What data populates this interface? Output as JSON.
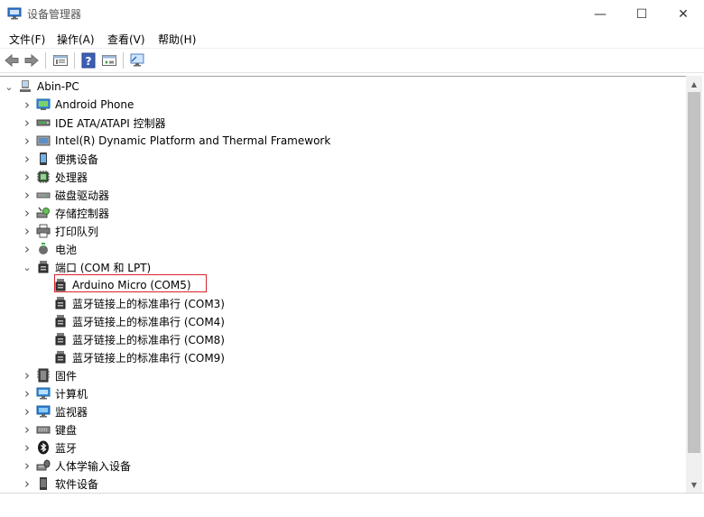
{
  "window": {
    "title": "设备管理器",
    "minimize_glyph": "—",
    "maximize_glyph": "☐",
    "close_glyph": "✕"
  },
  "menu": {
    "items": [
      "文件(F)",
      "操作(A)",
      "查看(V)",
      "帮助(H)"
    ]
  },
  "toolbar": {
    "icons": [
      "back-arrow-icon",
      "forward-arrow-icon",
      "properties-icon",
      "help-icon",
      "view-icon",
      "scan-monitor-icon"
    ]
  },
  "tree": {
    "root_label": "Abin-PC",
    "items": [
      {
        "label": "Android Phone",
        "icon": "android-phone-icon"
      },
      {
        "label": "IDE ATA/ATAPI 控制器",
        "icon": "ide-controller-icon"
      },
      {
        "label": "Intel(R) Dynamic Platform and Thermal Framework",
        "icon": "intel-framework-icon"
      },
      {
        "label": "便携设备",
        "icon": "portable-device-icon"
      },
      {
        "label": "处理器",
        "icon": "processor-icon"
      },
      {
        "label": "磁盘驱动器",
        "icon": "disk-drive-icon"
      },
      {
        "label": "存储控制器",
        "icon": "storage-controller-icon"
      },
      {
        "label": "打印队列",
        "icon": "print-queue-icon"
      },
      {
        "label": "电池",
        "icon": "battery-icon"
      },
      {
        "label": "端口 (COM 和 LPT)",
        "icon": "port-icon",
        "expanded": true
      },
      {
        "label": "Arduino Micro (COM5)",
        "icon": "port-icon",
        "child": true
      },
      {
        "label": "蓝牙链接上的标准串行 (COM3)",
        "icon": "port-icon",
        "child": true
      },
      {
        "label": "蓝牙链接上的标准串行 (COM4)",
        "icon": "port-icon",
        "child": true
      },
      {
        "label": "蓝牙链接上的标准串行 (COM8)",
        "icon": "port-icon",
        "child": true
      },
      {
        "label": "蓝牙链接上的标准串行 (COM9)",
        "icon": "port-icon",
        "child": true
      },
      {
        "label": "固件",
        "icon": "firmware-icon"
      },
      {
        "label": "计算机",
        "icon": "computer-icon"
      },
      {
        "label": "监视器",
        "icon": "monitor-icon"
      },
      {
        "label": "键盘",
        "icon": "keyboard-icon"
      },
      {
        "label": "蓝牙",
        "icon": "bluetooth-icon"
      },
      {
        "label": "人体学输入设备",
        "icon": "hid-icon"
      },
      {
        "label": "软件设备",
        "icon": "software-device-icon"
      }
    ]
  },
  "colors": {
    "highlight_border": "#d6252b",
    "scrollbar_thumb": "#c2c2c2"
  }
}
